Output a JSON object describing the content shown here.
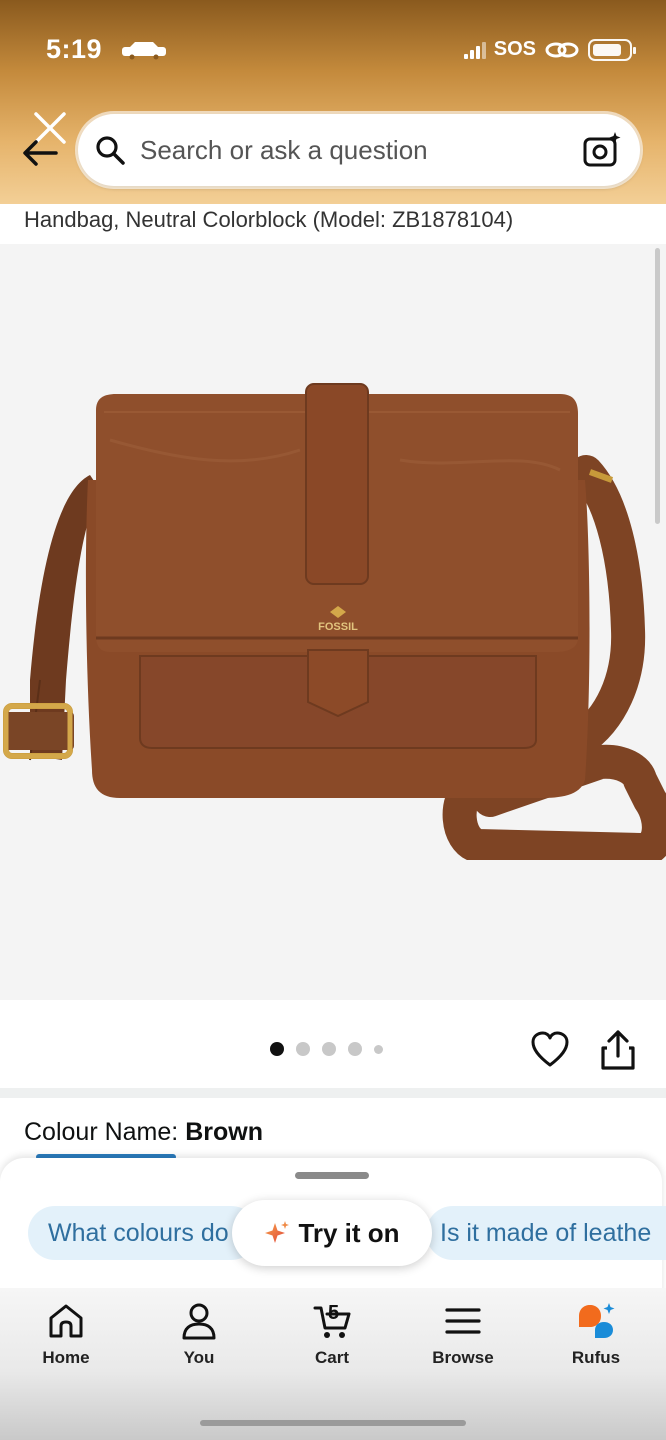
{
  "status_bar": {
    "time": "5:19",
    "carrier": "SOS"
  },
  "search": {
    "placeholder": "Search or ask a question"
  },
  "product": {
    "title": "Handbag, Neutral Colorblock (Model: ZB1878104)",
    "brand_mark": "FOSSIL",
    "image_count": 5,
    "active_image_index": 0,
    "colour_label": "Colour Name:",
    "colour_value": "Brown"
  },
  "rufus_panel": {
    "chips": [
      "What colours do",
      "Is it made of leathe"
    ],
    "try_it_on": "Try it on"
  },
  "tabbar": {
    "items": [
      {
        "label": "Home",
        "icon": "home-icon"
      },
      {
        "label": "You",
        "icon": "person-icon"
      },
      {
        "label": "Cart",
        "icon": "cart-icon"
      },
      {
        "label": "Browse",
        "icon": "menu-icon"
      },
      {
        "label": "Rufus",
        "icon": "rufus-icon"
      }
    ],
    "cart_count": "5"
  },
  "colors": {
    "accent_blue": "#2f6f9f",
    "chip_bg": "#e3f1fa",
    "header_top": "#8a5a1e",
    "leather": "#8a4a28"
  }
}
